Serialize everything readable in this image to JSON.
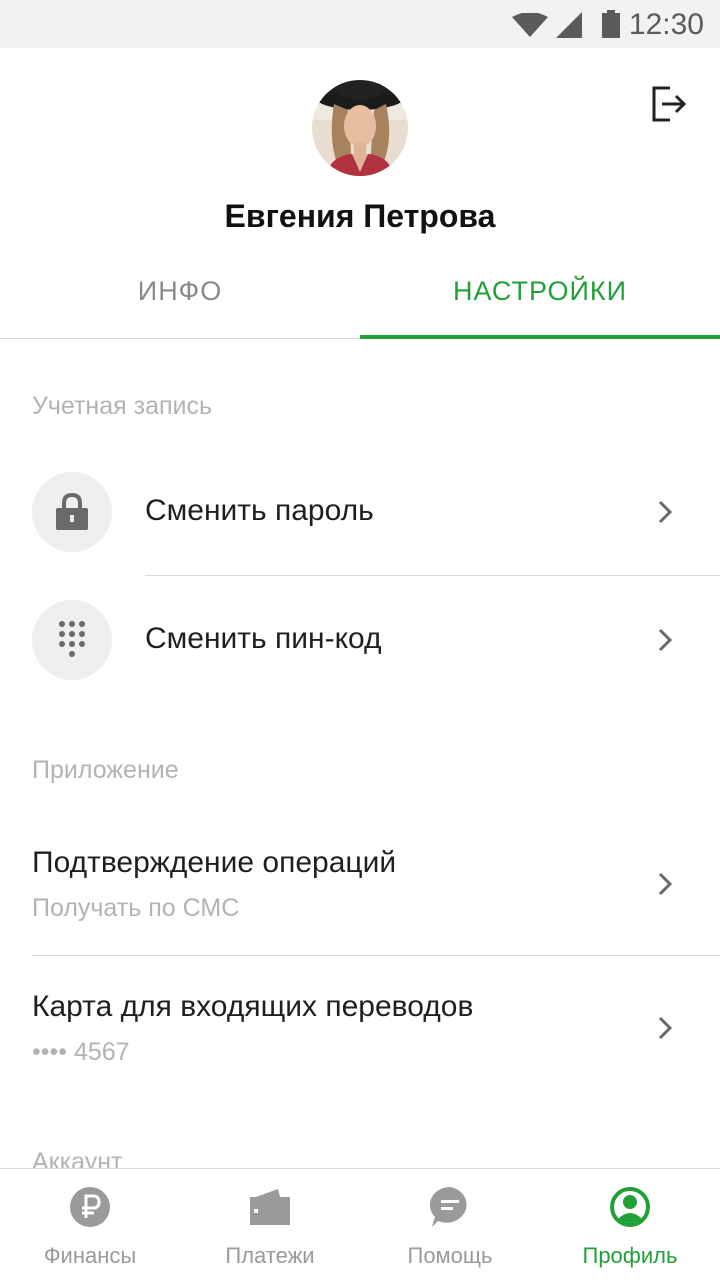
{
  "status_bar": {
    "time": "12:30"
  },
  "profile": {
    "name": "Евгения Петрова"
  },
  "tabs": [
    {
      "label": "ИНФО",
      "active": false
    },
    {
      "label": "НАСТРОЙКИ",
      "active": true
    }
  ],
  "sections": {
    "account": {
      "title": "Учетная запись",
      "items": [
        {
          "label": "Сменить пароль",
          "icon": "lock-icon"
        },
        {
          "label": "Сменить пин-код",
          "icon": "keypad-icon"
        }
      ]
    },
    "app": {
      "title": "Приложение",
      "items": [
        {
          "label": "Подтверждение операций",
          "sublabel": "Получать по СМС"
        },
        {
          "label": "Карта для входящих переводов",
          "sublabel": "•••• 4567"
        }
      ]
    },
    "next_title": "Аккаунт"
  },
  "bottom_nav": [
    {
      "label": "Финансы",
      "icon": "ruble-icon",
      "active": false
    },
    {
      "label": "Платежи",
      "icon": "wallet-icon",
      "active": false
    },
    {
      "label": "Помощь",
      "icon": "chat-icon",
      "active": false
    },
    {
      "label": "Профиль",
      "icon": "profile-icon",
      "active": true
    }
  ],
  "colors": {
    "accent": "#21a038",
    "muted": "#b3b3b3",
    "icon_grey": "#9a9a9a"
  }
}
